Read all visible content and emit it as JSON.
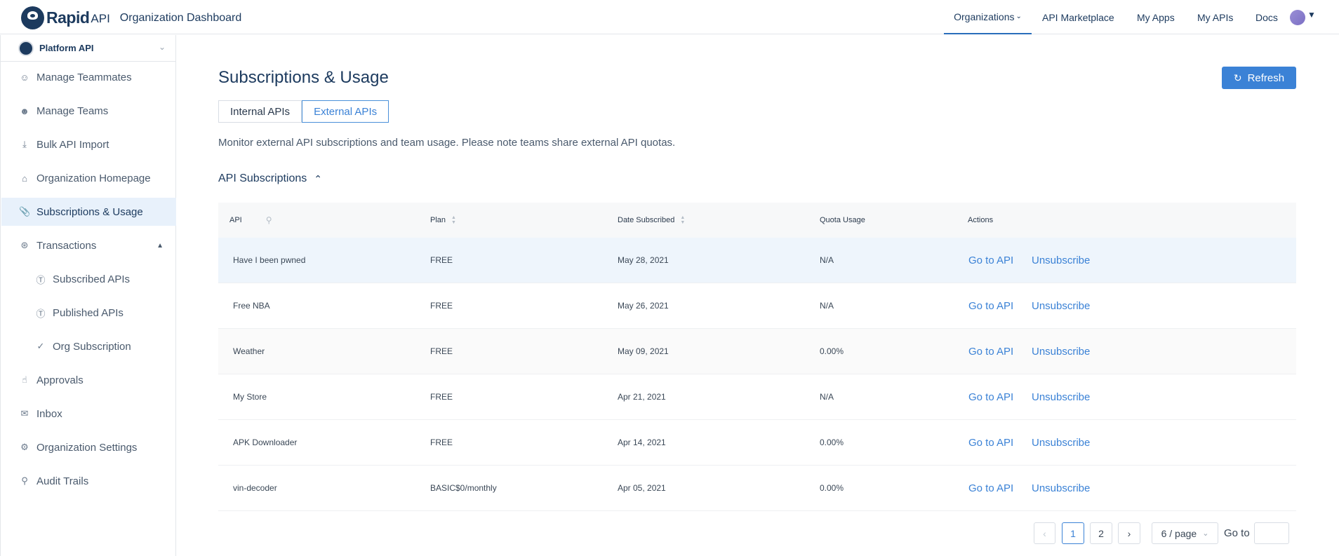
{
  "header": {
    "brand_rapid": "Rapid",
    "brand_api": "API",
    "title": "Organization Dashboard",
    "nav": [
      {
        "label": "Organizations",
        "active": true
      },
      {
        "label": "API Marketplace"
      },
      {
        "label": "My Apps"
      },
      {
        "label": "My APIs"
      },
      {
        "label": "Docs"
      }
    ]
  },
  "sidebar": {
    "org_name": "Platform API",
    "items": [
      {
        "label": "Manage Teammates",
        "icon": "user-icon"
      },
      {
        "label": "Manage Teams",
        "icon": "users-icon"
      },
      {
        "label": "Bulk API Import",
        "icon": "import-icon"
      },
      {
        "label": "Organization Homepage",
        "icon": "home-icon"
      },
      {
        "label": "Subscriptions & Usage",
        "icon": "paperclip-icon",
        "active": true
      },
      {
        "label": "Transactions",
        "icon": "cart-icon"
      },
      {
        "label": "Subscribed APIs",
        "icon": "dollar-circle-icon"
      },
      {
        "label": "Published APIs",
        "icon": "dollar-circle-icon"
      },
      {
        "label": "Org Subscription",
        "icon": "check-circle-icon"
      },
      {
        "label": "Approvals",
        "icon": "thumbs-up-icon"
      },
      {
        "label": "Inbox",
        "icon": "mail-icon"
      },
      {
        "label": "Organization Settings",
        "icon": "gear-icon"
      },
      {
        "label": "Audit Trails",
        "icon": "search-icon"
      }
    ]
  },
  "main": {
    "title": "Subscriptions & Usage",
    "refresh_label": "Refresh",
    "tabs": [
      {
        "label": "Internal APIs"
      },
      {
        "label": "External APIs",
        "active": true
      }
    ],
    "description": "Monitor external API subscriptions and team usage. Please note teams share external API quotas.",
    "section_title": "API Subscriptions",
    "table": {
      "columns": [
        "API",
        "Plan",
        "Date Subscribed",
        "Quota Usage",
        "Actions"
      ],
      "rows": [
        {
          "api": "Have I been pwned",
          "plan": "FREE",
          "date": "May 28, 2021",
          "quota": "N/A"
        },
        {
          "api": "Free NBA",
          "plan": "FREE",
          "date": "May 26, 2021",
          "quota": "N/A"
        },
        {
          "api": "Weather",
          "plan": "FREE",
          "date": "May 09, 2021",
          "quota": "0.00%"
        },
        {
          "api": "My Store",
          "plan": "FREE",
          "date": "Apr 21, 2021",
          "quota": "N/A"
        },
        {
          "api": "APK Downloader",
          "plan": "FREE",
          "date": "Apr 14, 2021",
          "quota": "0.00%"
        },
        {
          "api": "vin-decoder",
          "plan": "BASIC$0/monthly",
          "date": "Apr 05, 2021",
          "quota": "0.00%"
        }
      ],
      "action_goto": "Go to API",
      "action_unsub": "Unsubscribe"
    },
    "pagination": {
      "pages": [
        "1",
        "2"
      ],
      "current": "1",
      "page_size": "6 / page",
      "goto_label": "Go to"
    }
  },
  "colors": {
    "brand": "#1c3a5e",
    "accent": "#3b82d6",
    "active_bg": "#e8f1fb"
  }
}
